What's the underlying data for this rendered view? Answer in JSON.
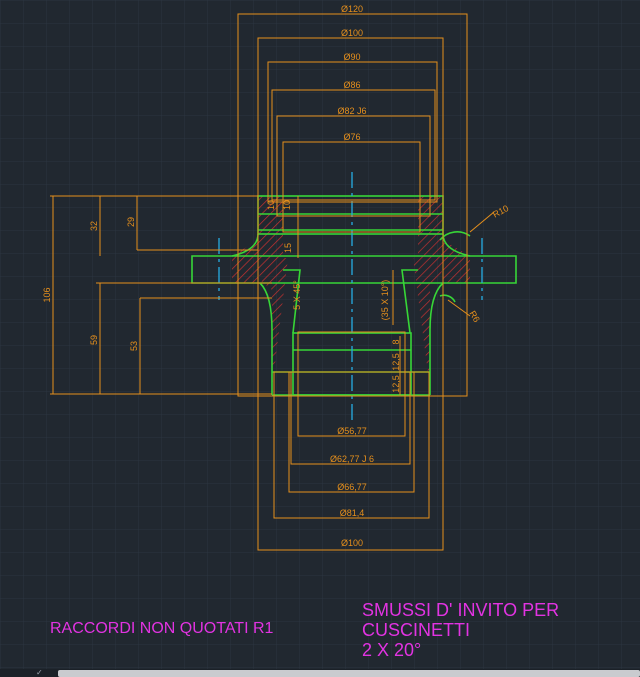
{
  "colors": {
    "background": "#212830",
    "grid": "#2c3540",
    "dimension": "#e58f1c",
    "outline": "#37d637",
    "centerline": "#27a3d6",
    "hatch": "#c43030",
    "note": "#e233e2"
  },
  "drawing": {
    "dimensions_top": [
      "Ø120",
      "Ø100",
      "Ø90",
      "Ø86",
      "Ø82 J6",
      "Ø76"
    ],
    "dimensions_bottom": [
      "Ø56,77",
      "Ø62,77 J 6",
      "Ø66,77",
      "Ø81,4",
      "Ø100"
    ],
    "dimensions_left": [
      "32",
      "29",
      "106",
      "59",
      "53"
    ],
    "dimensions_inner": [
      "10",
      "10",
      "15",
      "5 X 45°",
      "(35 X 10°)",
      "8",
      "12,5",
      "12,5"
    ],
    "radius_labels": [
      "R10",
      "R6"
    ]
  },
  "notes": {
    "left": "RACCORDI NON QUOTATI  R1",
    "right_lines": [
      "SMUSSI D' INVITO PER",
      "CUSCINETTI",
      "2 X 20°"
    ]
  }
}
